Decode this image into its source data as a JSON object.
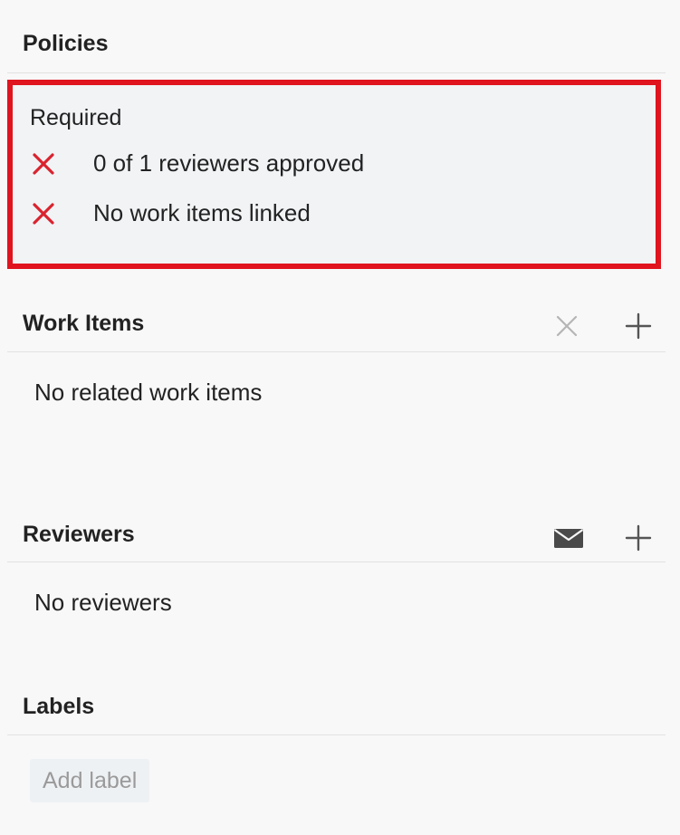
{
  "policies": {
    "title": "Policies",
    "required_label": "Required",
    "items": [
      {
        "text": "0 of 1 reviewers approved",
        "status": "failed",
        "icon": "x-icon"
      },
      {
        "text": "No work items linked",
        "status": "failed",
        "icon": "x-icon"
      }
    ],
    "highlight_color": "#e0141e",
    "failed_color": "#d9232e"
  },
  "work_items": {
    "title": "Work Items",
    "empty_text": "No related work items",
    "actions": [
      {
        "name": "remove",
        "icon": "close-icon",
        "enabled": false
      },
      {
        "name": "add",
        "icon": "plus-icon",
        "enabled": true
      }
    ]
  },
  "reviewers": {
    "title": "Reviewers",
    "empty_text": "No reviewers",
    "actions": [
      {
        "name": "email",
        "icon": "envelope-icon"
      },
      {
        "name": "add",
        "icon": "plus-icon"
      }
    ]
  },
  "labels": {
    "title": "Labels",
    "add_label": "Add label"
  }
}
